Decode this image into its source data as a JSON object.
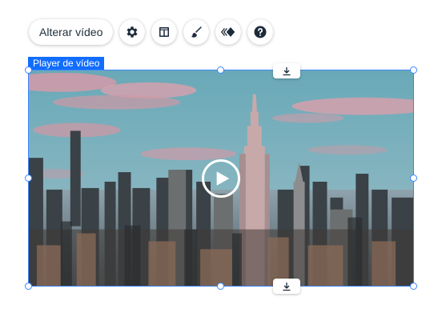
{
  "toolbar": {
    "change_video_label": "Alterar vídeo",
    "buttons": [
      {
        "icon": "gear-icon"
      },
      {
        "icon": "layout-icon"
      },
      {
        "icon": "brush-icon"
      },
      {
        "icon": "animation-icon"
      },
      {
        "icon": "help-icon"
      }
    ]
  },
  "component": {
    "label": "Player de vídeo",
    "accent_color": "#116dff",
    "border_color": "#3b86ff"
  },
  "video": {
    "play_icon": "play-icon",
    "top_chip_icon": "download-icon",
    "bottom_chip_icon": "download-icon"
  }
}
